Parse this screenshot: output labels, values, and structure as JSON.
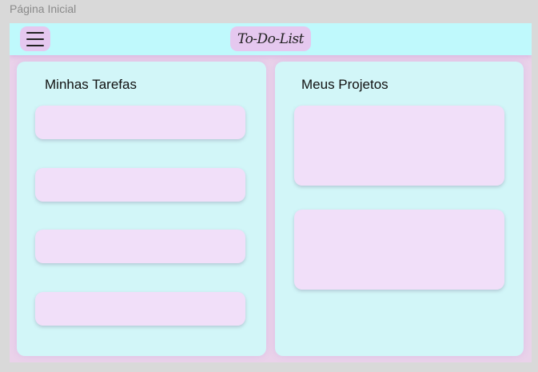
{
  "frame": {
    "label": "Página Inicial"
  },
  "header": {
    "menu_icon": "hamburger-menu-icon",
    "title": "To-Do-List"
  },
  "tasks_panel": {
    "title": "Minhas Tarefas",
    "cards": [
      "",
      "",
      "",
      ""
    ]
  },
  "projects_panel": {
    "title": "Meus Projetos",
    "cards": [
      "",
      ""
    ]
  },
  "colors": {
    "topbar": "#bff9fc",
    "panel": "#d2f6f8",
    "card": "#f1dff9",
    "button": "#e5c8ef",
    "frame_bg": "#ead2ea"
  }
}
